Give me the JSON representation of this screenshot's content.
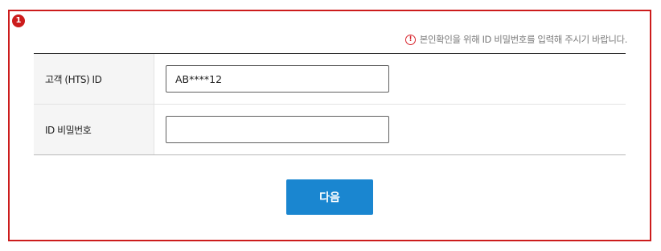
{
  "annotation": {
    "badge": "1",
    "border_color": "#cc1c1c"
  },
  "notice": {
    "icon": "exclamation-circle-icon",
    "text": "본인확인을 위해 ID 비밀번호를 입력해 주시기 바랍니다."
  },
  "form": {
    "rows": [
      {
        "label": "고객 (HTS) ID",
        "value": "AB****12",
        "placeholder": ""
      },
      {
        "label": "ID 비밀번호",
        "value": "",
        "placeholder": ""
      }
    ]
  },
  "actions": {
    "next_label": "다음",
    "next_color": "#1a86d0"
  }
}
